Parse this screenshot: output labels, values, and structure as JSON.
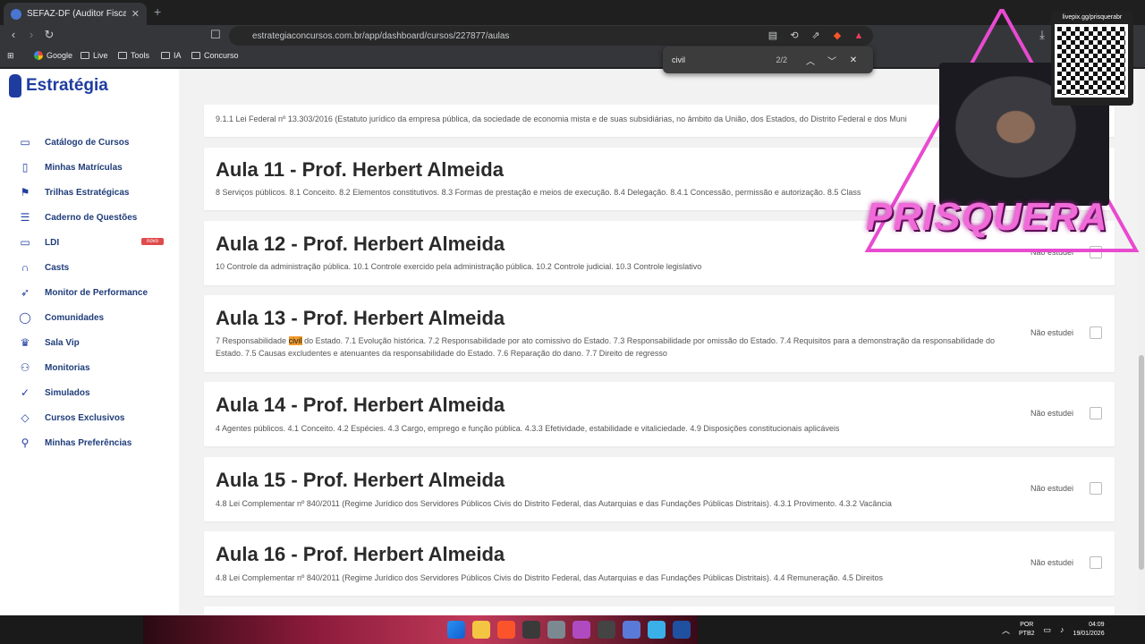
{
  "browser": {
    "tab_title": "SEFAZ-DF (Auditor Fiscal) Direito",
    "url": "estrategiaconcursos.com.br/app/dashboard/cursos/227877/aulas",
    "bookmarks": [
      "Google",
      "Live",
      "Tools",
      "IA",
      "Concurso"
    ]
  },
  "find": {
    "term": "civil",
    "count": "2/2"
  },
  "brand": "Estratégia",
  "sidebar": {
    "items": [
      {
        "label": "Catálogo de Cursos",
        "icon": "monitor-icon"
      },
      {
        "label": "Minhas Matrículas",
        "icon": "book-icon"
      },
      {
        "label": "Trilhas Estratégicas",
        "icon": "flag-icon"
      },
      {
        "label": "Caderno de Questões",
        "icon": "list-icon"
      },
      {
        "label": "LDI",
        "icon": "screen-icon",
        "badge": "novo"
      },
      {
        "label": "Casts",
        "icon": "headphones-icon"
      },
      {
        "label": "Monitor de Performance",
        "icon": "rocket-icon"
      },
      {
        "label": "Comunidades",
        "icon": "chat-icon"
      },
      {
        "label": "Sala Vip",
        "icon": "crown-icon"
      },
      {
        "label": "Monitorias",
        "icon": "users-icon"
      },
      {
        "label": "Simulados",
        "icon": "check-circle-icon"
      },
      {
        "label": "Cursos Exclusivos",
        "icon": "diamond-icon"
      },
      {
        "label": "Minhas Preferências",
        "icon": "user-icon"
      }
    ]
  },
  "lessons": {
    "partial_desc": "9.1.1 Lei Federal nº 13.303/2016 (Estatuto jurídico da empresa pública, da sociedade de economia mista e de suas subsidiárias, no âmbito da União, dos Estados, do Distrito Federal e dos Muni",
    "status_label": "Não estudei",
    "items": [
      {
        "title": "Aula 11 - Prof. Herbert Almeida",
        "desc": "8 Serviços públicos. 8.1 Conceito. 8.2 Elementos constitutivos. 8.3 Formas de prestação e meios de execução. 8.4 Delegação. 8.4.1 Concessão, permissão e autorização. 8.5 Class"
      },
      {
        "title": "Aula 12 - Prof. Herbert Almeida",
        "desc": "10 Controle da administração pública. 10.1 Controle exercido pela administração pública. 10.2 Controle judicial. 10.3 Controle legislativo"
      },
      {
        "title": "Aula 13 - Prof. Herbert Almeida",
        "desc_pre": "7 Responsabilidade ",
        "desc_hl": "civil",
        "desc_post": " do Estado. 7.1 Evolução histórica. 7.2 Responsabilidade por ato comissivo do Estado. 7.3 Responsabilidade por omissão do Estado. 7.4 Requisitos para a demonstração da responsabilidade do Estado. 7.5 Causas excludentes e atenuantes da responsabilidade do Estado. 7.6 Reparação do dano. 7.7 Direito de regresso"
      },
      {
        "title": "Aula 14 - Prof. Herbert Almeida",
        "desc": "4 Agentes públicos. 4.1 Conceito. 4.2 Espécies. 4.3 Cargo, emprego e função pública. 4.3.3 Efetividade, estabilidade e vitaliciedade. 4.9 Disposições constitucionais aplicáveis"
      },
      {
        "title": "Aula 15 - Prof. Herbert Almeida",
        "desc": "4.8 Lei Complementar nº 840/2011 (Regime Jurídico dos Servidores Públicos Civis do Distrito Federal, das Autarquias e das Fundações Públicas Distritais). 4.3.1 Provimento. 4.3.2 Vacância"
      },
      {
        "title": "Aula 16 - Prof. Herbert Almeida",
        "desc": "4.8 Lei Complementar nº 840/2011 (Regime Jurídico dos Servidores Públicos Civis do Distrito Federal, das Autarquias e das Fundações Públicas Distritais). 4.4 Remuneração. 4.5 Direitos"
      }
    ]
  },
  "taskbar": {
    "lang": "POR",
    "layout": "PTB2",
    "time": "04:09",
    "date": "19/01/2026"
  },
  "stream": {
    "qr_label": "livepix.gg/prisquerabr",
    "watermark": "PRISQUERA"
  }
}
